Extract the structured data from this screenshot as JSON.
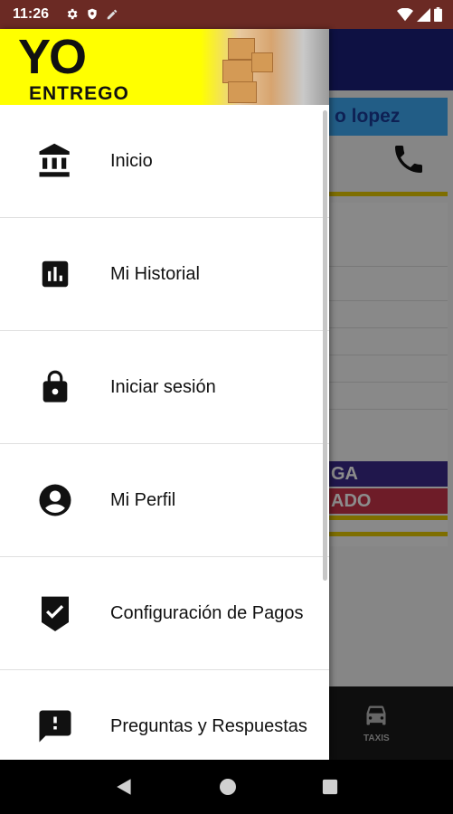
{
  "status_bar": {
    "time": "11:26",
    "left_icons": [
      "gear-icon",
      "shield-icon",
      "pen-icon"
    ],
    "right_icons": [
      "wifi-icon",
      "signal-icon",
      "battery-icon"
    ]
  },
  "background_app": {
    "name_chip": "o lopez",
    "status_labels": [
      {
        "text": "GA",
        "color": "#3b2a8a"
      },
      {
        "text": "ADO",
        "color": "#c8334a"
      }
    ],
    "bottom_nav_label": "TAXIS"
  },
  "drawer": {
    "logo": {
      "line1": "YO",
      "line2": "ENTREGO"
    },
    "items": [
      {
        "label": "Inicio",
        "icon": "bank-icon"
      },
      {
        "label": "Mi Historial",
        "icon": "bar-chart-icon"
      },
      {
        "label": "Iniciar sesión",
        "icon": "lock-icon"
      },
      {
        "label": "Mi Perfil",
        "icon": "account-circle-icon"
      },
      {
        "label": "Configuración de Pagos",
        "icon": "verified-shield-icon"
      },
      {
        "label": "Preguntas y Respuestas",
        "icon": "feedback-icon"
      }
    ]
  },
  "nav_bar": {
    "buttons": [
      "back-icon",
      "home-icon",
      "recents-icon"
    ]
  },
  "colors": {
    "status_bar": "#6b2a24",
    "toolbar": "#1b1f7a",
    "drawer_header": "#ffff00",
    "chip": "#3fa9f5"
  }
}
